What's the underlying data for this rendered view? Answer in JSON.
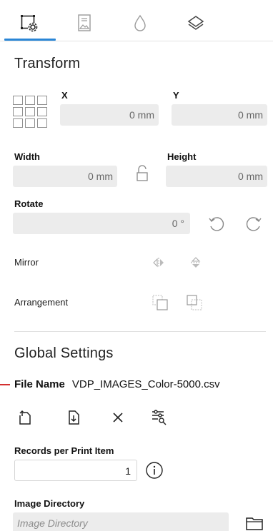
{
  "tabs": [
    {
      "icon": "transform-icon",
      "active": true
    },
    {
      "icon": "image-document-icon",
      "active": false
    },
    {
      "icon": "color-drop-icon",
      "active": false
    },
    {
      "icon": "layers-icon",
      "active": false
    }
  ],
  "colors": {
    "accent": "#2a86d6",
    "marker": "#d32f2f",
    "field_bg": "#ececec"
  },
  "transform": {
    "title": "Transform",
    "x_label": "X",
    "y_label": "Y",
    "x_value": "0 mm",
    "y_value": "0 mm",
    "width_label": "Width",
    "height_label": "Height",
    "width_value": "0 mm",
    "height_value": "0 mm",
    "rotate_label": "Rotate",
    "rotate_value": "0 °",
    "mirror_label": "Mirror",
    "arrangement_label": "Arrangement"
  },
  "global": {
    "title": "Global Settings",
    "file_name_label": "File Name",
    "file_name_value": "VDP_IMAGES_Color-5000.csv",
    "records_label": "Records per Print Item",
    "records_value": "1",
    "image_dir_label": "Image Directory",
    "image_dir_placeholder": "Image Directory"
  }
}
